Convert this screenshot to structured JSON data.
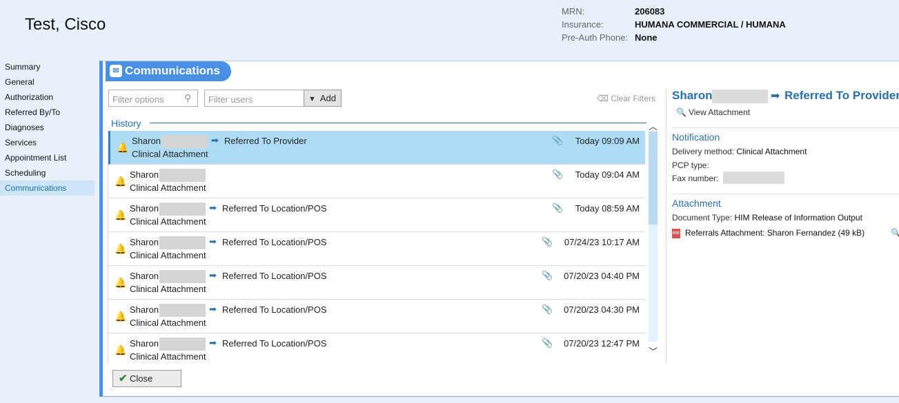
{
  "header": {
    "patient_name": "Test, Cisco",
    "mrn_label": "MRN:",
    "mrn_value": "206083",
    "insurance_label": "Insurance:",
    "insurance_value": "HUMANA COMMERCIAL / HUMANA",
    "preauth_label": "Pre-Auth Phone:",
    "preauth_value": "None"
  },
  "nav": {
    "items": [
      {
        "label": "Summary"
      },
      {
        "label": "General"
      },
      {
        "label": "Authorization"
      },
      {
        "label": "Referred By/To"
      },
      {
        "label": "Diagnoses"
      },
      {
        "label": "Services"
      },
      {
        "label": "Appointment List"
      },
      {
        "label": "Scheduling"
      },
      {
        "label": "Communications",
        "active": true
      }
    ]
  },
  "dialog": {
    "title": "Communications",
    "filter_options_placeholder": "Filter options",
    "filter_users_placeholder": "Filter users",
    "add_label": "Add",
    "clear_filters_label": "Clear Filters",
    "history_label": "History",
    "close_label": "Close",
    "history": [
      {
        "sender": "Sharon",
        "action": "Referred To Provider",
        "type": "Clinical Attachment",
        "time": "Today 09:09 AM",
        "selected": true
      },
      {
        "sender": "Sharon",
        "action": "",
        "type": "Clinical Attachment",
        "time": "Today 09:04 AM",
        "selected": false
      },
      {
        "sender": "Sharon",
        "action": "Referred To Location/POS",
        "type": "Clinical Attachment",
        "time": "Today 08:59 AM",
        "selected": false
      },
      {
        "sender": "Sharon",
        "action": "Referred To Location/POS",
        "type": "Clinical Attachment",
        "time": "07/24/23 10:17 AM",
        "selected": false
      },
      {
        "sender": "Sharon",
        "action": "Referred To Location/POS",
        "type": "Clinical Attachment",
        "time": "07/20/23 04:40 PM",
        "selected": false
      },
      {
        "sender": "Sharon",
        "action": "Referred To Location/POS",
        "type": "Clinical Attachment",
        "time": "07/20/23 04:30 PM",
        "selected": false
      },
      {
        "sender": "Sharon",
        "action": "Referred To Location/POS",
        "type": "Clinical Attachment",
        "time": "07/20/23 12:47 PM",
        "selected": false
      }
    ]
  },
  "detail": {
    "title_name": "Sharon",
    "title_action": "Referred To Provider",
    "view_attachment_label": "View Attachment",
    "notification_heading": "Notification",
    "delivery_label": "Delivery method:",
    "delivery_value": "Clinical Attachment",
    "pcp_label": "PCP type:",
    "fax_label": "Fax number:",
    "attachment_heading": "Attachment",
    "doc_type_label": "Document Type:",
    "doc_type_value": "HIM Release of Information Output",
    "attachment_file": "Referrals Attachment: Sharon Fernandez (49 kB)",
    "pdf_icon_text": "PDF"
  },
  "icons": {
    "arrow": "➡",
    "bell": "🔔",
    "paperclip": "📎",
    "funnel": "▼",
    "search": "⚲",
    "check": "✔",
    "chevron_up": "︿",
    "chevron_down": "﹀"
  },
  "colors": {
    "accent": "#4a90e2",
    "link_blue": "#2a70a8",
    "selected_row": "#aedcf6",
    "background": "#e8f1fa"
  }
}
